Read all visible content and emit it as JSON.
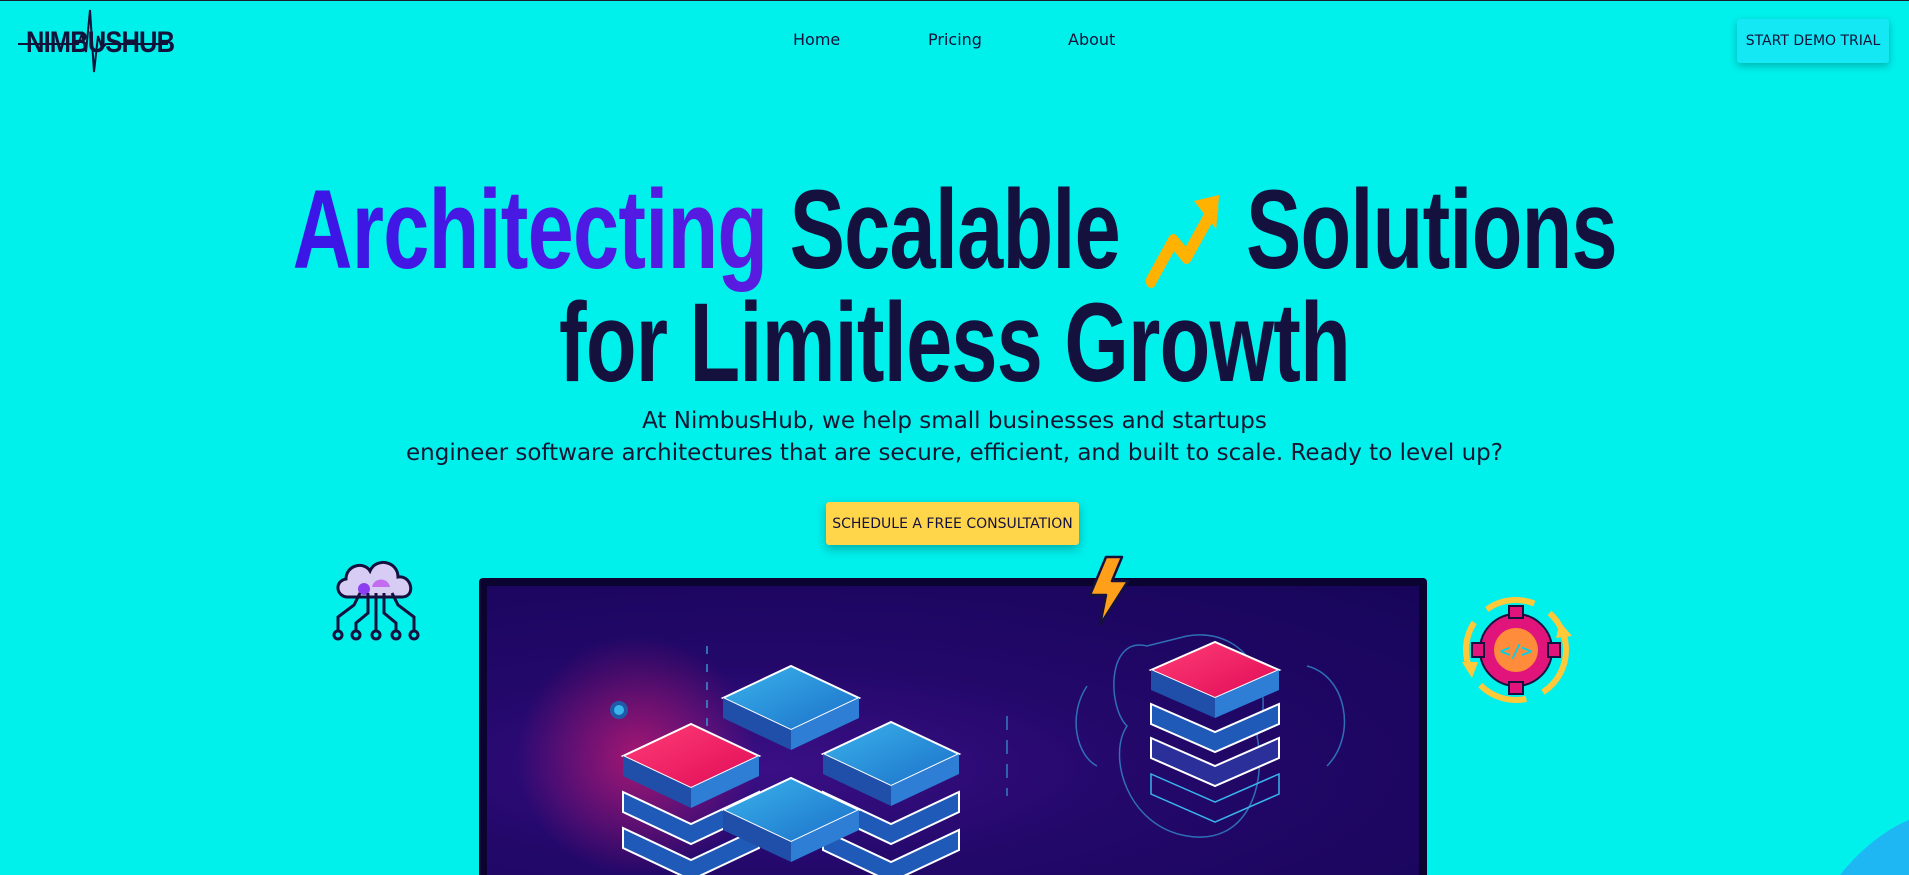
{
  "brand": {
    "logo_text": "NIMBUSHUB"
  },
  "nav": {
    "items": [
      {
        "label": "Home"
      },
      {
        "label": "Pricing"
      },
      {
        "label": "About"
      }
    ],
    "demo_button": "START DEMO TRIAL"
  },
  "hero": {
    "headline_accent": "Architecting",
    "headline_rest_1": "Scalable",
    "headline_rest_2": "Solutions",
    "headline_line2": "for Limitless Growth",
    "subtitle_line1": "At NimbusHub, we help small businesses and startups",
    "subtitle_line2": "engineer software architectures that are secure, efficient, and built to scale. Ready to level up?",
    "cta_label": "SCHEDULE A FREE CONSULTATION"
  },
  "colors": {
    "background": "#00f0ec",
    "headline": "#14113e",
    "accent": "#3a16e6",
    "cta": "#ffd64a",
    "demo_button": "#14e8f4"
  },
  "icons": [
    "growth-arrow-icon",
    "cloud-network-icon",
    "lightning-icon",
    "code-gear-icon",
    "server-stack-illustration"
  ]
}
